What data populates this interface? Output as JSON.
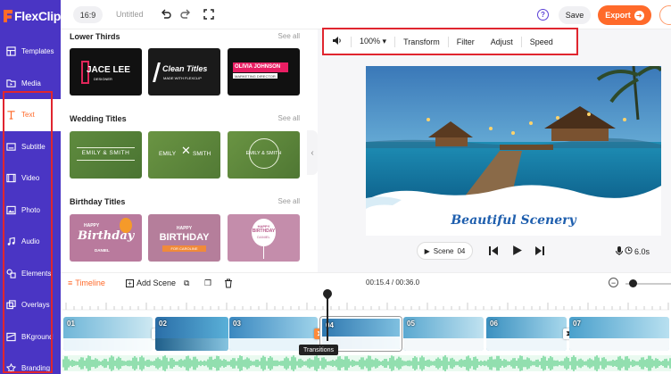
{
  "app": {
    "logo": "FlexClip"
  },
  "sidebar": {
    "items": [
      {
        "label": "Templates",
        "icon": "templates-icon"
      },
      {
        "label": "Media",
        "icon": "media-icon"
      },
      {
        "label": "Text",
        "icon": "text-icon",
        "active": true
      },
      {
        "label": "Subtitle",
        "icon": "subtitle-icon"
      },
      {
        "label": "Video",
        "icon": "video-icon"
      },
      {
        "label": "Photo",
        "icon": "photo-icon"
      },
      {
        "label": "Audio",
        "icon": "audio-icon"
      },
      {
        "label": "Elements",
        "icon": "elements-icon"
      },
      {
        "label": "Overlays",
        "icon": "overlays-icon"
      },
      {
        "label": "BKground",
        "icon": "background-icon"
      },
      {
        "label": "Branding",
        "icon": "branding-icon"
      }
    ]
  },
  "topbar": {
    "ratio": "16:9",
    "project_title": "Untitled",
    "help": "?",
    "save_label": "Save",
    "export_label": "Export"
  },
  "panel": {
    "sections": [
      {
        "title": "Lower Thirds",
        "see_all": "See all",
        "thumbs": [
          {
            "line1": "JACE LEE",
            "line2": "DESIGNER"
          },
          {
            "line1": "Clean Titles",
            "line2": "MADE WITH FLEXCLIP"
          },
          {
            "line1": "OLIVIA JOHNSON",
            "line2": "MARKETING DIRECTOR"
          }
        ]
      },
      {
        "title": "Wedding Titles",
        "see_all": "See all",
        "thumbs": [
          {
            "line1": "EMILY & SMITH"
          },
          {
            "line1": "EMILY",
            "line2": "SMITH"
          },
          {
            "line1": "EMILY & SMITH"
          }
        ]
      },
      {
        "title": "Birthday Titles",
        "see_all": "See all",
        "thumbs": [
          {
            "line1": "HAPPY",
            "line2": "Birthday",
            "line3": "DANIEL"
          },
          {
            "line1": "HAPPY",
            "line2": "BIRTHDAY",
            "line3": "FOR CAROLINE"
          },
          {
            "line1": "HAPPY",
            "line2": "BIRTHDAY",
            "line3": "DANIEL"
          }
        ]
      }
    ]
  },
  "toolbar": {
    "zoom": "100%",
    "transform": "Transform",
    "filter": "Filter",
    "adjust": "Adjust",
    "speed": "Speed"
  },
  "preview": {
    "scene_caption": "Beautiful Scenery",
    "scene_label": "Scene",
    "scene_num": "04",
    "duration": "6.0s"
  },
  "timeline": {
    "label": "Timeline",
    "add_scene": "Add Scene",
    "time": "00:15.4 / 00:36.0",
    "tooltip": "Transitions",
    "clips": [
      "01",
      "02",
      "03",
      "04",
      "05",
      "06",
      "07"
    ]
  },
  "colors": {
    "sidebar": "#4a35c4",
    "accent": "#ff6a2a",
    "highlight": "#e0262f"
  }
}
